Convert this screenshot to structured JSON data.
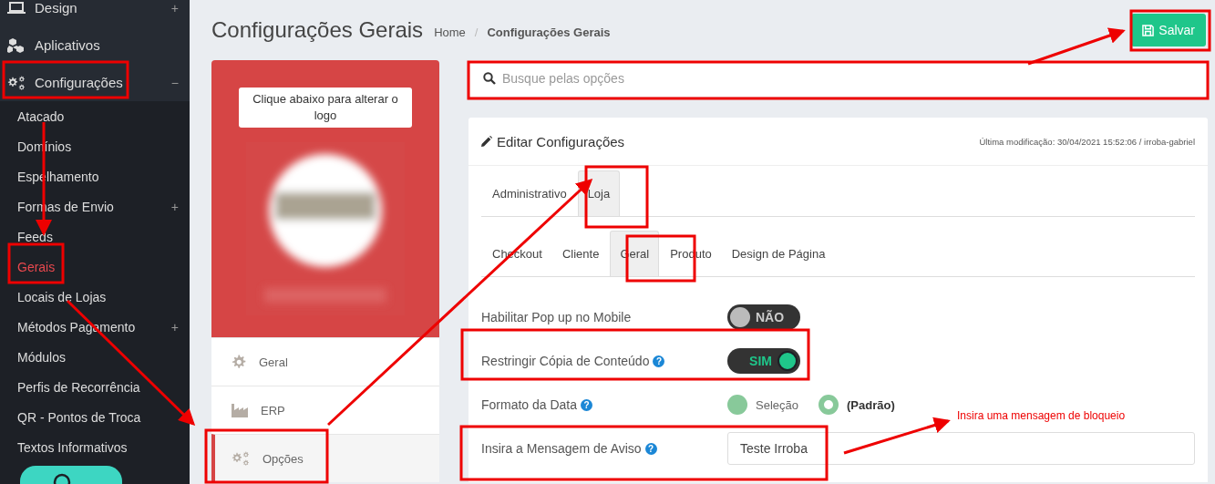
{
  "sidebar": {
    "items": [
      {
        "label": "Design",
        "toggle": "+"
      },
      {
        "label": "Aplicativos"
      },
      {
        "label": "Configurações",
        "toggle": "−",
        "children": [
          {
            "label": "Atacado",
            "selected": false
          },
          {
            "label": "Domínios",
            "selected": false
          },
          {
            "label": "Espelhamento",
            "selected": false
          },
          {
            "label": "Formas de Envio",
            "toggle": "+",
            "selected": false
          },
          {
            "label": "Feeds",
            "selected": false
          },
          {
            "label": "Gerais",
            "selected": true
          },
          {
            "label": "Locais de Lojas",
            "selected": false
          },
          {
            "label": "Métodos Pagamento",
            "toggle": "+",
            "selected": false
          },
          {
            "label": "Módulos",
            "selected": false
          },
          {
            "label": "Perfis de Recorrência",
            "selected": false
          },
          {
            "label": "QR - Pontos de Troca",
            "selected": false
          },
          {
            "label": "Textos Informativos",
            "selected": false
          }
        ]
      }
    ]
  },
  "page_title": "Configurações Gerais",
  "breadcrumb": {
    "separator": "/",
    "items": [
      "Home",
      "Configurações Gerais"
    ]
  },
  "save_button": "Salvar",
  "search": {
    "placeholder": "Busque pelas opções"
  },
  "logo_card": {
    "hint": "Clique abaixo para alterar o logo"
  },
  "side_menu": [
    {
      "label": "Geral",
      "selected": false
    },
    {
      "label": "ERP",
      "selected": false
    },
    {
      "label": "Opções",
      "selected": true
    }
  ],
  "panel": {
    "title": "Editar Configurações",
    "last_modified": "Última modificação: 30/04/2021 15:52:06 / irroba-gabriel",
    "tabs": [
      {
        "label": "Administrativo",
        "selected": false
      },
      {
        "label": "Loja",
        "selected": true
      }
    ],
    "subtabs": [
      {
        "label": "Checkout",
        "selected": false
      },
      {
        "label": "Cliente",
        "selected": false
      },
      {
        "label": "Geral",
        "selected": true
      },
      {
        "label": "Produto",
        "selected": false
      },
      {
        "label": "Design de Página",
        "selected": false
      }
    ],
    "fields": [
      {
        "kind": "toggle",
        "label": "Habilitar Pop up no Mobile",
        "on": false,
        "text": "NÃO"
      },
      {
        "kind": "toggle",
        "label": "Restringir Cópia de Conteúdo",
        "help": "?",
        "on": true,
        "text": "SIM"
      },
      {
        "kind": "radio",
        "label": "Formato da Data",
        "help": "?",
        "options": [
          {
            "label": "Seleção",
            "selected": false
          },
          {
            "label": "(Padrão)",
            "selected": true
          }
        ]
      },
      {
        "kind": "text",
        "label": "Insira a Mensagem de Aviso",
        "help": "?",
        "value": "Teste Irroba"
      }
    ]
  },
  "annotation": {
    "note": "Insira uma mensagem de bloqueio"
  }
}
